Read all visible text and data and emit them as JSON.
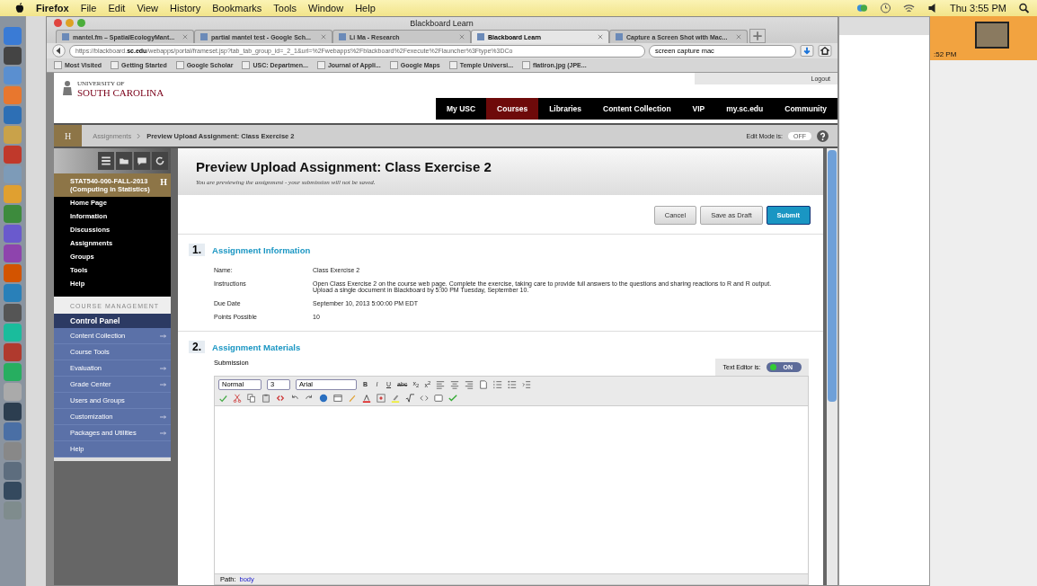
{
  "menubar": {
    "app": "Firefox",
    "menus": [
      "File",
      "Edit",
      "View",
      "History",
      "Bookmarks",
      "Tools",
      "Window",
      "Help"
    ],
    "clock": "Thu 3:55 PM"
  },
  "browser": {
    "title": "Blackboard Learn",
    "tabs": [
      {
        "label": "mantel.fm – SpatialEcologyMant...",
        "selected": false
      },
      {
        "label": "partial mantel test - Google Sch...",
        "selected": false
      },
      {
        "label": "Li Ma - Research",
        "selected": false
      },
      {
        "label": "Blackboard Learn",
        "selected": true
      },
      {
        "label": "Capture a Screen Shot with Mac...",
        "selected": false
      }
    ],
    "url": "https://blackboard.**sc.edu**/webapps/portal/frameset.jsp?tab_tab_group_id=_2_1&url=%2Fwebapps%2Fblackboard%2Fexecute%2Flauncher%3Ftype%3DCo",
    "search": "screen capture mac",
    "bookmarks": [
      "Most Visited",
      "Getting Started",
      "Google Scholar",
      "USC: Departmen...",
      "Journal of Appli...",
      "Google Maps",
      "Temple Universi...",
      "flatiron.jpg (JPE..."
    ]
  },
  "header": {
    "logo_small": "UNIVERSITY OF",
    "logo": "SOUTH CAROLINA",
    "logout": "Logout",
    "nav": [
      {
        "label": "My USC",
        "selected": false
      },
      {
        "label": "Courses",
        "selected": true
      },
      {
        "label": "Libraries",
        "selected": false
      },
      {
        "label": "Content Collection",
        "selected": false
      },
      {
        "label": "VIP",
        "selected": false
      },
      {
        "label": "my.sc.edu",
        "selected": false
      },
      {
        "label": "Community",
        "selected": false
      }
    ]
  },
  "breadcrumb": {
    "home": "H",
    "items": [
      "Assignments",
      "Preview Upload Assignment: Class Exercise 2"
    ],
    "edit_mode_label": "Edit Mode is:",
    "edit_mode_on": false,
    "edit_mode_state": "OFF"
  },
  "sidebar": {
    "course": "STAT540-000-FALL-2013 (Computing in Statistics)",
    "course_badge": "H",
    "course_items": [
      "Home Page",
      "Information",
      "Discussions",
      "Assignments",
      "Groups",
      "Tools",
      "Help"
    ],
    "management_heading": "COURSE MANAGEMENT",
    "control_panel": "Control Panel",
    "control_items": [
      {
        "label": "Content Collection",
        "arrow": true
      },
      {
        "label": "Course Tools",
        "arrow": false
      },
      {
        "label": "Evaluation",
        "arrow": true
      },
      {
        "label": "Grade Center",
        "arrow": true
      },
      {
        "label": "Users and Groups",
        "arrow": false
      },
      {
        "label": "Customization",
        "arrow": true
      },
      {
        "label": "Packages and Utilities",
        "arrow": true
      },
      {
        "label": "Help",
        "arrow": false
      }
    ]
  },
  "page": {
    "title": "Preview Upload Assignment: Class Exercise 2",
    "subtitle": "You are previewing the assignment - your submission will not be saved.",
    "buttons": [
      {
        "label": "Cancel",
        "kind": "secondary"
      },
      {
        "label": "Save as Draft",
        "kind": "secondary"
      },
      {
        "label": "Submit",
        "kind": "primary"
      }
    ],
    "sections": [
      {
        "number": "1.",
        "title": "Assignment Information"
      },
      {
        "number": "2.",
        "title": "Assignment Materials"
      }
    ],
    "fields": [
      {
        "label": "Name:",
        "value": "Class Exercise 2"
      },
      {
        "label": "Instructions",
        "value": " Open Class Exercise 2 on the course web page.  Complete the exercise, taking care to provide full answers to the questions and sharing reactions to R and R output.  Upload  a single document in Blackboard by 5:00  PM Tuesday, September 10."
      },
      {
        "label": "Due Date",
        "value": "September 10, 2013 5:00:00 PM EDT"
      },
      {
        "label": "Points Possible",
        "value": "10"
      }
    ],
    "submission_label": "Submission",
    "editor": {
      "toggle_label": "Text Editor is:",
      "on": true,
      "state": "ON",
      "format": "Normal",
      "size": "3",
      "font": "Arial",
      "text_buttons": [
        {
          "label": "B",
          "kind": "bold"
        },
        {
          "label": "I",
          "kind": "italic"
        },
        {
          "label": "U",
          "kind": "underline"
        },
        {
          "label": "abc",
          "kind": "strike"
        },
        {
          "label": "x$_{2}$",
          "kind": "plain"
        },
        {
          "label": "x$^{2}$",
          "kind": "plain"
        }
      ],
      "path_label": "Path:",
      "path": "body"
    }
  },
  "background": {
    "clock_fragment": ":52 PM"
  }
}
